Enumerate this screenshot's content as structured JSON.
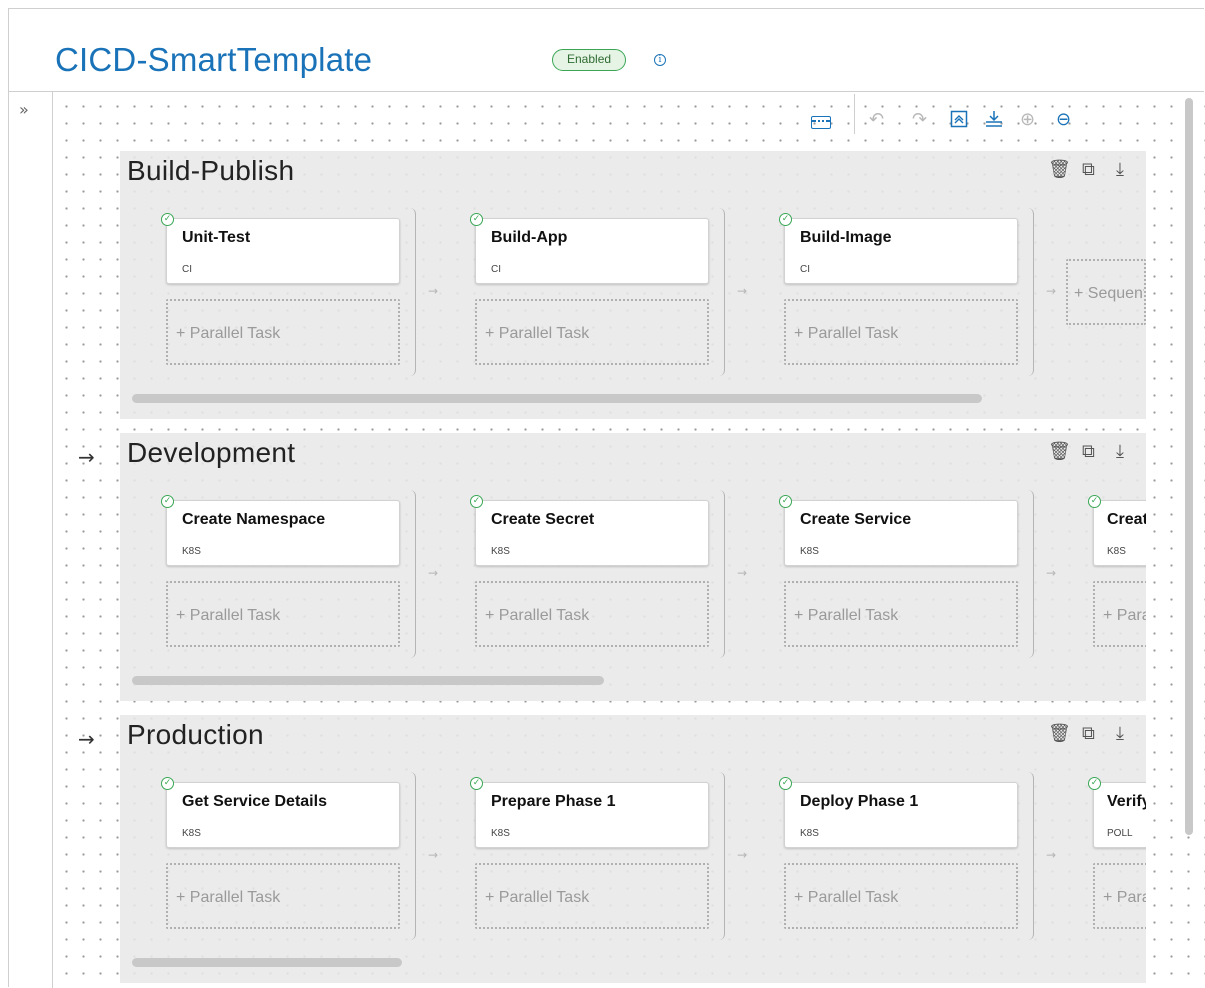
{
  "header": {
    "title": "CICD-SmartTemplate",
    "status": "Enabled",
    "info_glyph": "i"
  },
  "sidebar": {
    "toggle_glyph": "»"
  },
  "toolbar": {
    "keyboard": "keyboard-icon",
    "undo": "↶",
    "redo": "↷",
    "collapse": "collapse-all-icon",
    "import": "import-icon",
    "zoom_in": "⊕",
    "zoom_out": "⊖"
  },
  "stages": [
    {
      "title": "Build-Publish",
      "tasks": [
        {
          "name": "Unit-Test",
          "type": "CI"
        },
        {
          "name": "Build-App",
          "type": "CI"
        },
        {
          "name": "Build-Image",
          "type": "CI"
        }
      ],
      "parallel_label": "+ Parallel Task",
      "sequential_label": "+ Sequential Task"
    },
    {
      "title": "Development",
      "tasks": [
        {
          "name": "Create Namespace",
          "type": "K8S"
        },
        {
          "name": "Create Secret",
          "type": "K8S"
        },
        {
          "name": "Create Service",
          "type": "K8S"
        },
        {
          "name": "Create",
          "type": "K8S"
        }
      ],
      "parallel_label": "+ Parallel Task"
    },
    {
      "title": "Production",
      "tasks": [
        {
          "name": "Get Service Details",
          "type": "K8S"
        },
        {
          "name": "Prepare Phase 1",
          "type": "K8S"
        },
        {
          "name": "Deploy Phase 1",
          "type": "K8S"
        },
        {
          "name": "Verify",
          "type": "POLL"
        }
      ],
      "parallel_label": "+ Parallel Task"
    }
  ],
  "stage_icons": {
    "delete": "🗑",
    "copy": "⧉",
    "download": "⤓"
  },
  "arrows": {
    "stage": "→",
    "sequence": "→"
  },
  "colors": {
    "brand": "#1a73b8",
    "success": "#3aa655",
    "stage_bg": "#e8e8e8"
  }
}
